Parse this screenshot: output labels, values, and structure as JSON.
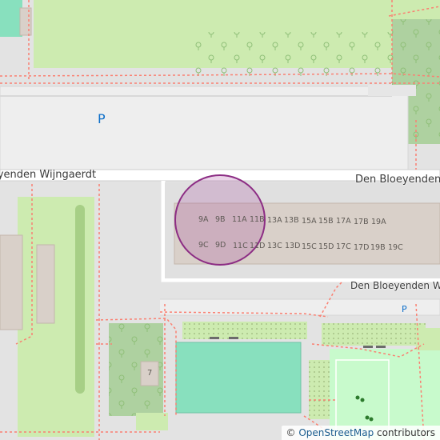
{
  "map": {
    "streets": [
      "Den Bloeyenden Wijngaerdt",
      "Den Bloeyenden Wijngaerdt",
      "Den Bloeyenden Wijngaerdt"
    ],
    "parking_symbol": "P",
    "house_numbers_row1": [
      "9A",
      "9B",
      "11A",
      "11B",
      "13A",
      "13B",
      "15A",
      "15B",
      "17A",
      "17B",
      "19A"
    ],
    "house_numbers_row2": [
      "9C",
      "9D",
      "11C",
      "11D",
      "13C",
      "13D",
      "15C",
      "15D",
      "17C",
      "17D",
      "19B",
      "19C"
    ],
    "building_number": "7",
    "marker_icon": "circle-location-marker",
    "colors": {
      "background": "#e3e3e3",
      "road": "#ffffff",
      "park": "#c8facc",
      "grass": "#cdebb0",
      "building": "#d9d0c9",
      "pitch": "#88e0be",
      "scrub": "#c8d7ab",
      "footway": "#fa8072",
      "marker": "#a03c96"
    }
  },
  "attribution": {
    "copyright": "©",
    "link_text": "OpenStreetMap",
    "suffix": "contributors"
  }
}
